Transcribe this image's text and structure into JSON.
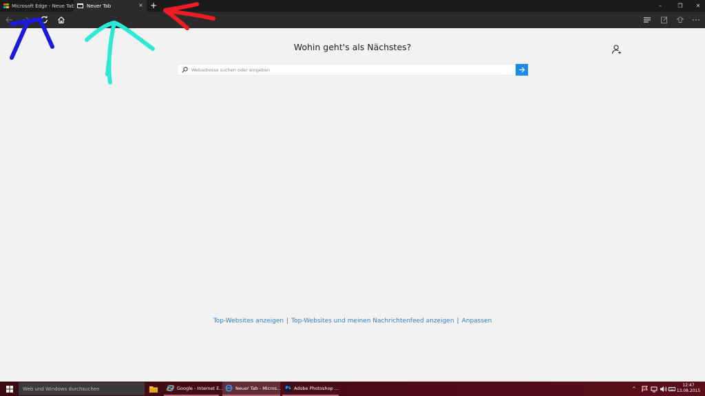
{
  "tabs": [
    {
      "label": "Microsoft Edge - Neue Tabs",
      "icon": "windows-logo-icon",
      "active": false
    },
    {
      "label": "Neuer Tab",
      "icon": "tab-page-icon",
      "active": true
    }
  ],
  "tab_close_glyph": "×",
  "new_tab_glyph": "+",
  "window_controls": {
    "minimize": "–",
    "restore": "❐",
    "close": "✕"
  },
  "navigation": {
    "back": "back-arrow-icon",
    "forward": "forward-arrow-icon",
    "refresh": "refresh-icon",
    "home": "home-icon",
    "right_icons": [
      "hub-icon",
      "web-note-icon",
      "share-icon",
      "more-icon"
    ]
  },
  "main": {
    "heading": "Wohin geht's als Nächstes?",
    "search_placeholder": "Webadresse suchen oder eingeben",
    "search_value": "",
    "bottom_links": [
      "Top-Websites anzeigen",
      "Top-Websites und meinen Nachrichtenfeed anzeigen",
      "Anpassen"
    ],
    "link_separator": "|"
  },
  "taskbar": {
    "search_placeholder": "Web und Windows durchsuchen",
    "items": [
      {
        "label": "Google - Internet E...",
        "icon": "internet-explorer-icon",
        "active": false
      },
      {
        "label": "Neuer Tab - Micros...",
        "icon": "edge-icon",
        "active": true
      },
      {
        "label": "Adobe Photoshop ...",
        "icon": "photoshop-icon",
        "active": false
      }
    ],
    "photoshop_icon_text": "Ps",
    "tray_chevron": "^",
    "time": "12:47",
    "date": "13.08.2015"
  },
  "colors": {
    "accent": "#1b8ae8",
    "link": "#2f7fc7",
    "tabbar": "#1b1b1b",
    "navbar": "#2b2b2b",
    "taskbar": "#4a0c16",
    "annotation_blue": "#1a1adf",
    "annotation_cyan": "#2ee8d6",
    "annotation_red": "#ee1c24"
  }
}
